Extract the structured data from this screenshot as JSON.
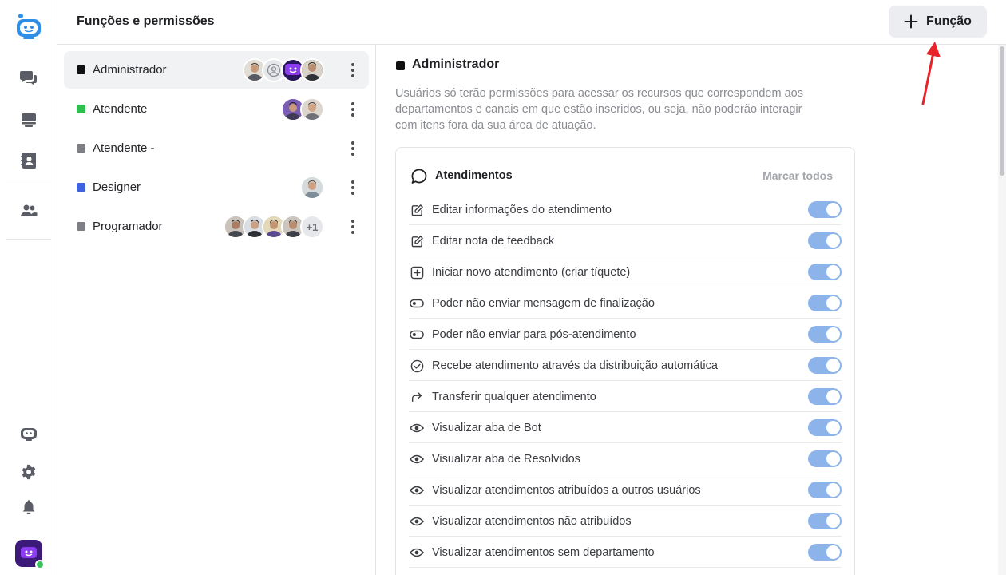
{
  "header": {
    "title": "Funções e permissões",
    "add_button_label": "Função"
  },
  "rail": {
    "icons": [
      "bot-logo-icon",
      "chat-icon",
      "inbox-icon",
      "contacts-icon",
      "team-icon",
      "bot-icon",
      "gear-icon",
      "bell-icon"
    ],
    "status": "online"
  },
  "roles": [
    {
      "name": "Administrador",
      "color": "#111111",
      "active": true,
      "avatars": [
        "user-photo",
        "placeholder",
        "bot-avatar",
        "user-photo"
      ],
      "extra": ""
    },
    {
      "name": "Atendente",
      "color": "#2fbe4f",
      "active": false,
      "avatars": [
        "user-photo",
        "user-photo"
      ],
      "extra": ""
    },
    {
      "name": "Atendente -",
      "color": "#7d7f85",
      "active": false,
      "avatars": [],
      "extra": ""
    },
    {
      "name": "Designer",
      "color": "#3e63dd",
      "active": false,
      "avatars": [
        "user-photo"
      ],
      "extra": ""
    },
    {
      "name": "Programador",
      "color": "#7d7f85",
      "active": false,
      "avatars": [
        "user-photo",
        "user-photo",
        "user-photo",
        "user-photo"
      ],
      "extra": "+1"
    }
  ],
  "detail": {
    "title": "Administrador",
    "description": "Usuários só terão permissões para acessar os recursos que correspondem aos departamentos e canais em que estão inseridos, ou seja, não poderão interagir com itens fora da sua área de atuação.",
    "section": {
      "title": "Atendimentos",
      "mark_all": "Marcar todos",
      "permissions": [
        {
          "label": "Editar informações do atendimento",
          "icon": "edit-icon",
          "enabled": true
        },
        {
          "label": "Editar nota de feedback",
          "icon": "edit-icon",
          "enabled": true
        },
        {
          "label": "Iniciar novo atendimento (criar tíquete)",
          "icon": "plus-square-icon",
          "enabled": true
        },
        {
          "label": "Poder não enviar mensagem de finalização",
          "icon": "toggle-icon",
          "enabled": true
        },
        {
          "label": "Poder não enviar para pós-atendimento",
          "icon": "toggle-icon",
          "enabled": true
        },
        {
          "label": "Recebe atendimento através da distribuição automática",
          "icon": "check-circle-icon",
          "enabled": true
        },
        {
          "label": "Transferir qualquer atendimento",
          "icon": "forward-icon",
          "enabled": true
        },
        {
          "label": "Visualizar aba de Bot",
          "icon": "eye-icon",
          "enabled": true
        },
        {
          "label": "Visualizar aba de Resolvidos",
          "icon": "eye-icon",
          "enabled": true
        },
        {
          "label": "Visualizar atendimentos atribuídos a outros usuários",
          "icon": "eye-icon",
          "enabled": true
        },
        {
          "label": "Visualizar atendimentos não atribuídos",
          "icon": "eye-icon",
          "enabled": true
        },
        {
          "label": "Visualizar atendimentos sem departamento",
          "icon": "eye-icon",
          "enabled": true
        }
      ]
    }
  },
  "colors": {
    "accent_toggle": "#8db4ea",
    "annotation_arrow": "#e8232a",
    "rail_icon": "#5a5d65",
    "logo": "#2f8fe6"
  }
}
